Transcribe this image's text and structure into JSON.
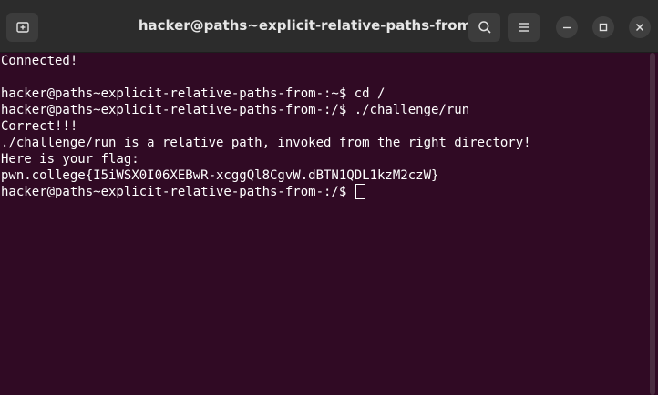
{
  "window": {
    "title": "hacker@paths~explicit-relative-paths-from-: /"
  },
  "icons": {
    "new_tab": "new-tab-icon",
    "search": "search-icon",
    "menu": "hamburger-menu-icon",
    "minimize": "minimize-icon",
    "maximize": "maximize-icon",
    "close": "close-icon"
  },
  "colors": {
    "terminal_bg": "#300a24",
    "titlebar_bg": "#2c2c2c",
    "text": "#ffffff"
  },
  "terminal": {
    "lines": [
      "Connected!",
      "",
      "hacker@paths~explicit-relative-paths-from-:~$ cd /",
      "hacker@paths~explicit-relative-paths-from-:/$ ./challenge/run",
      "Correct!!!",
      "./challenge/run is a relative path, invoked from the right directory!",
      "Here is your flag:",
      "pwn.college{I5iWSX0I06XEBwR-xcggQl8CgvW.dBTN1QDL1kzM2czW}"
    ],
    "prompt": "hacker@paths~explicit-relative-paths-from-:/$ "
  }
}
